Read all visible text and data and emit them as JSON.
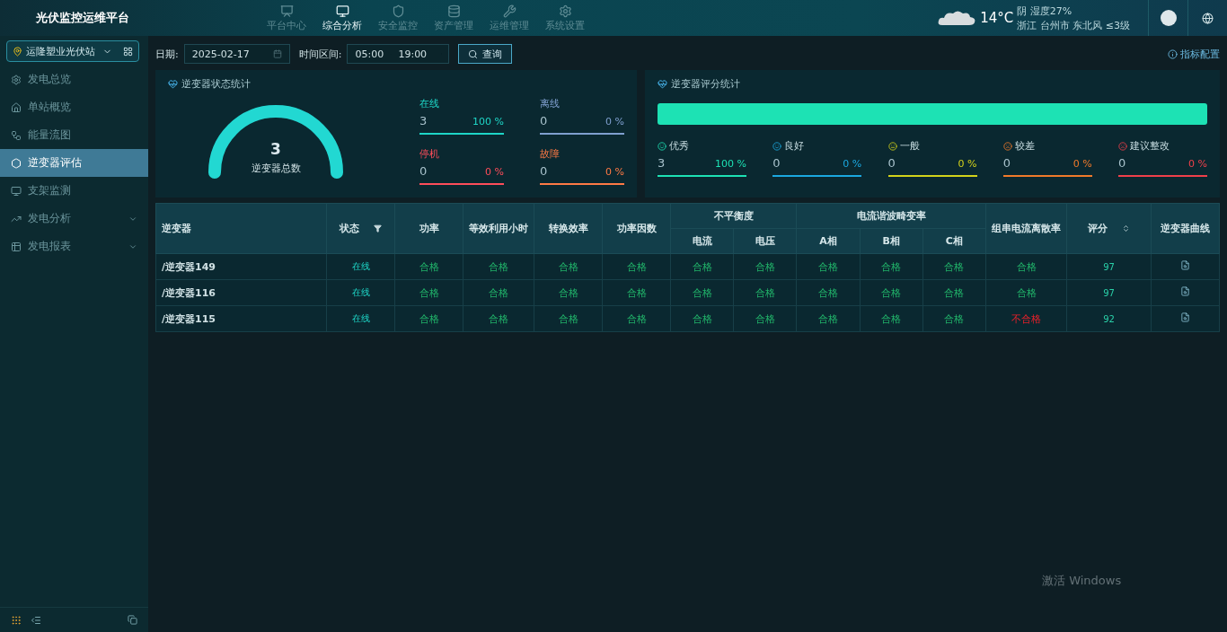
{
  "header": {
    "title": "光伏监控运维平台",
    "nav": [
      {
        "label": "平台中心",
        "selected": false
      },
      {
        "label": "综合分析",
        "selected": true
      },
      {
        "label": "安全监控",
        "selected": false
      },
      {
        "label": "资产管理",
        "selected": false
      },
      {
        "label": "运维管理",
        "selected": false
      },
      {
        "label": "系统设置",
        "selected": false
      }
    ],
    "weather": {
      "temperature": "14°C",
      "condition": "阴 湿度27%",
      "location": "浙江  台州市 东北风 ≤3级"
    }
  },
  "sidebar": {
    "station": "运隆塑业光伏站",
    "items": [
      {
        "label": "发电总览",
        "kind": "link",
        "selected": false
      },
      {
        "label": "单站概览",
        "kind": "link",
        "selected": false
      },
      {
        "label": "能量流图",
        "kind": "link",
        "selected": false
      },
      {
        "label": "逆变器评估",
        "kind": "link",
        "selected": true
      },
      {
        "label": "支架监测",
        "kind": "link",
        "selected": false
      },
      {
        "label": "发电分析",
        "kind": "group",
        "selected": false,
        "expanded": false
      },
      {
        "label": "发电报表",
        "kind": "group",
        "selected": false,
        "expanded": false
      }
    ]
  },
  "filters": {
    "date_label": "日期:",
    "date": "2025-02-17",
    "range_label": "时间区间:",
    "start": "05:00",
    "end": "19:00",
    "query_button": "查询",
    "config_link": "指标配置"
  },
  "status_card": {
    "title": "逆变器状态统计",
    "gauge": {
      "value": "3",
      "label": "逆变器总数",
      "level": 1
    },
    "stats": [
      {
        "label": "在线",
        "value": "3",
        "percent": "100 %",
        "color": "#1ed6c7"
      },
      {
        "label": "离线",
        "value": "0",
        "percent": "0 %",
        "color": "#7f9fcf"
      },
      {
        "label": "停机",
        "value": "0",
        "percent": "0 %",
        "color": "#ff4d5a"
      },
      {
        "label": "故障",
        "value": "0",
        "percent": "0 %",
        "color": "#ff7a45"
      }
    ]
  },
  "score_card": {
    "title": "逆变器评分统计",
    "grades": [
      {
        "label": "优秀",
        "value": "3",
        "percent": "100 %",
        "color": "#1de2b4"
      },
      {
        "label": "良好",
        "value": "0",
        "percent": "0 %",
        "color": "#1ba8e0"
      },
      {
        "label": "一般",
        "value": "0",
        "percent": "0 %",
        "color": "#d4d21a"
      },
      {
        "label": "较差",
        "value": "0",
        "percent": "0 %",
        "color": "#f07a2a"
      },
      {
        "label": "建议整改",
        "value": "0",
        "percent": "0 %",
        "color": "#f0404a"
      }
    ]
  },
  "table": {
    "columns": {
      "inverter": "逆变器",
      "status": "状态",
      "power": "功率",
      "hours": "等效利用小时",
      "efficiency": "转换效率",
      "power_factor": "功率因数",
      "imbalance": "不平衡度",
      "imbalance_current": "电流",
      "imbalance_voltage": "电压",
      "harmonic": "电流谐波畸变率",
      "phase_a": "A相",
      "phase_b": "B相",
      "phase_c": "C相",
      "dispersion": "组串电流离散率",
      "score": "评分",
      "curve": "逆变器曲线"
    },
    "rows": [
      {
        "name": "/逆变器149",
        "status": "在线",
        "checks": [
          {
            "text": "合格",
            "passed": true
          },
          {
            "text": "合格",
            "passed": true
          },
          {
            "text": "合格",
            "passed": true
          },
          {
            "text": "合格",
            "passed": true
          },
          {
            "text": "合格",
            "passed": true
          },
          {
            "text": "合格",
            "passed": true
          },
          {
            "text": "合格",
            "passed": true
          },
          {
            "text": "合格",
            "passed": true
          },
          {
            "text": "合格",
            "passed": true
          },
          {
            "text": "合格",
            "passed": true
          }
        ],
        "score": "97"
      },
      {
        "name": "/逆变器116",
        "status": "在线",
        "checks": [
          {
            "text": "合格",
            "passed": true
          },
          {
            "text": "合格",
            "passed": true
          },
          {
            "text": "合格",
            "passed": true
          },
          {
            "text": "合格",
            "passed": true
          },
          {
            "text": "合格",
            "passed": true
          },
          {
            "text": "合格",
            "passed": true
          },
          {
            "text": "合格",
            "passed": true
          },
          {
            "text": "合格",
            "passed": true
          },
          {
            "text": "合格",
            "passed": true
          },
          {
            "text": "合格",
            "passed": true
          }
        ],
        "score": "97"
      },
      {
        "name": "/逆变器115",
        "status": "在线",
        "checks": [
          {
            "text": "合格",
            "passed": true
          },
          {
            "text": "合格",
            "passed": true
          },
          {
            "text": "合格",
            "passed": true
          },
          {
            "text": "合格",
            "passed": true
          },
          {
            "text": "合格",
            "passed": true
          },
          {
            "text": "合格",
            "passed": true
          },
          {
            "text": "合格",
            "passed": true
          },
          {
            "text": "合格",
            "passed": true
          },
          {
            "text": "合格",
            "passed": true
          },
          {
            "text": "不合格",
            "passed": false
          }
        ],
        "score": "92"
      }
    ]
  },
  "os_notice": "激活 Windows"
}
